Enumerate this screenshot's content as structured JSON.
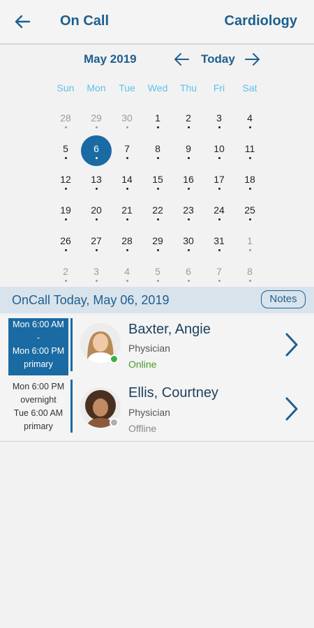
{
  "header": {
    "title": "On Call",
    "department": "Cardiology",
    "back_icon": "arrow-left-icon"
  },
  "calendar": {
    "month_label": "May 2019",
    "today_label": "Today",
    "weekdays": [
      "Sun",
      "Mon",
      "Tue",
      "Wed",
      "Thu",
      "Fri",
      "Sat"
    ],
    "selected_day": "6",
    "days": [
      {
        "n": "28",
        "muted": true
      },
      {
        "n": "29",
        "muted": true
      },
      {
        "n": "30",
        "muted": true
      },
      {
        "n": "1",
        "muted": false
      },
      {
        "n": "2",
        "muted": false
      },
      {
        "n": "3",
        "muted": false
      },
      {
        "n": "4",
        "muted": false
      },
      {
        "n": "5",
        "muted": false
      },
      {
        "n": "6",
        "muted": false
      },
      {
        "n": "7",
        "muted": false
      },
      {
        "n": "8",
        "muted": false
      },
      {
        "n": "9",
        "muted": false
      },
      {
        "n": "10",
        "muted": false
      },
      {
        "n": "11",
        "muted": false
      },
      {
        "n": "12",
        "muted": false
      },
      {
        "n": "13",
        "muted": false
      },
      {
        "n": "14",
        "muted": false
      },
      {
        "n": "15",
        "muted": false
      },
      {
        "n": "16",
        "muted": false
      },
      {
        "n": "17",
        "muted": false
      },
      {
        "n": "18",
        "muted": false
      },
      {
        "n": "19",
        "muted": false
      },
      {
        "n": "20",
        "muted": false
      },
      {
        "n": "21",
        "muted": false
      },
      {
        "n": "22",
        "muted": false
      },
      {
        "n": "23",
        "muted": false
      },
      {
        "n": "24",
        "muted": false
      },
      {
        "n": "25",
        "muted": false
      },
      {
        "n": "26",
        "muted": false
      },
      {
        "n": "27",
        "muted": false
      },
      {
        "n": "28",
        "muted": false
      },
      {
        "n": "29",
        "muted": false
      },
      {
        "n": "30",
        "muted": false
      },
      {
        "n": "31",
        "muted": false
      },
      {
        "n": "1",
        "muted": true
      },
      {
        "n": "2",
        "muted": true
      },
      {
        "n": "3",
        "muted": true
      },
      {
        "n": "4",
        "muted": true
      },
      {
        "n": "5",
        "muted": true
      },
      {
        "n": "6",
        "muted": true
      },
      {
        "n": "7",
        "muted": true
      },
      {
        "n": "8",
        "muted": true
      }
    ]
  },
  "oncall": {
    "section_title": "OnCall Today, May 06, 2019",
    "notes_label": "Notes",
    "entries": [
      {
        "shift_lines": [
          "Mon 6:00 AM",
          "-",
          "Mon 6:00 PM",
          "primary"
        ],
        "name": "Baxter, Angie",
        "role": "Physician",
        "status": "Online"
      },
      {
        "shift_lines": [
          "Mon 6:00 PM",
          "overnight",
          "Tue 6:00 AM",
          "primary"
        ],
        "name": "Ellis, Courtney",
        "role": "Physician",
        "status": "Offline"
      }
    ]
  },
  "colors": {
    "accent": "#1a6aa3",
    "title": "#1d5f8f",
    "weekday": "#5ec1ea",
    "online": "#3cb043",
    "offline": "#b0b0b0",
    "online_text": "#4a9a2a",
    "offline_text": "#888888"
  }
}
